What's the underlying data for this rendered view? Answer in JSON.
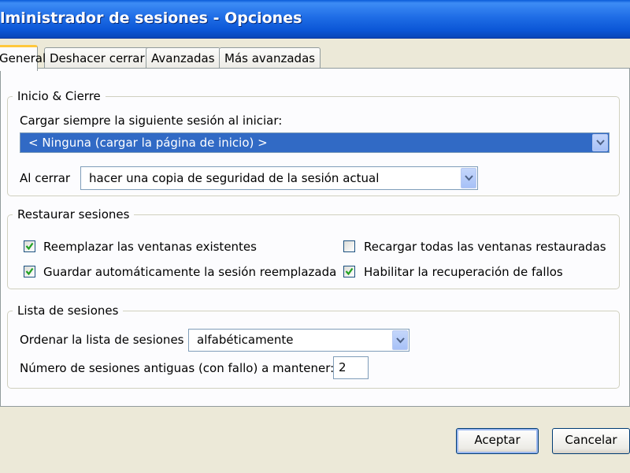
{
  "window": {
    "title": "lministrador de sesiones - Opciones"
  },
  "tabs": [
    {
      "label": "General"
    },
    {
      "label": "Deshacer cerrar"
    },
    {
      "label": "Avanzadas"
    },
    {
      "label": "Más avanzadas"
    }
  ],
  "startup": {
    "legend": "Inicio & Cierre",
    "load_label": "Cargar siempre la siguiente sesión al iniciar:",
    "load_value": "< Ninguna (cargar la página de inicio) >",
    "close_label": "Al cerrar",
    "close_value": "hacer una copia de seguridad de la sesión actual"
  },
  "restore": {
    "legend": "Restaurar sesiones",
    "options": [
      {
        "label": "Reemplazar las ventanas existentes",
        "checked": true
      },
      {
        "label": "Recargar todas las ventanas restauradas",
        "checked": false
      },
      {
        "label": "Guardar automáticamente la sesión reemplazada",
        "checked": true
      },
      {
        "label": "Habilitar la recuperación de fallos",
        "checked": true
      }
    ]
  },
  "session_list": {
    "legend": "Lista de sesiones",
    "sort_label": "Ordenar la lista de sesiones",
    "sort_value": "alfabéticamente",
    "keep_label": "Número de sesiones antiguas (con fallo) a mantener:",
    "keep_value": "2"
  },
  "buttons": {
    "ok": "Aceptar",
    "cancel": "Cancelar"
  },
  "colors": {
    "titlebar": "#0a5bd8",
    "selection": "#316ac5",
    "face": "#ece9d8"
  },
  "icons": {
    "dropdown": "chevron-down-icon",
    "check": "check-icon"
  }
}
